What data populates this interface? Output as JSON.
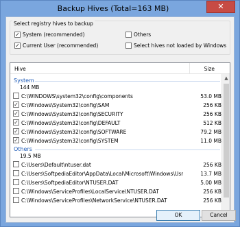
{
  "window": {
    "title": "Backup Hives (Total=163 MB)",
    "close_glyph": "✕"
  },
  "hive_select": {
    "legend": "Select registry hives to backup",
    "options": [
      {
        "label": "System (recommended)",
        "checked": true
      },
      {
        "label": "Current User (recommended)",
        "checked": true
      },
      {
        "label": "Others",
        "checked": false
      },
      {
        "label": "Select hives not loaded by Windows",
        "checked": false
      }
    ]
  },
  "list": {
    "col_hive": "Hive",
    "col_size": "Size",
    "groups": [
      {
        "title": "System",
        "size": "144 MB",
        "rows": [
          {
            "path": "C:\\WINDOWS\\system32\\config\\components",
            "size": "53.0 MB",
            "checked": false
          },
          {
            "path": "C:\\Windows\\System32\\config\\SAM",
            "size": "256 KB",
            "checked": true
          },
          {
            "path": "C:\\Windows\\System32\\config\\SECURITY",
            "size": "256 KB",
            "checked": true
          },
          {
            "path": "C:\\Windows\\System32\\config\\DEFAULT",
            "size": "512 KB",
            "checked": true
          },
          {
            "path": "C:\\Windows\\System32\\config\\SOFTWARE",
            "size": "79.2 MB",
            "checked": true
          },
          {
            "path": "C:\\Windows\\System32\\config\\SYSTEM",
            "size": "11.0 MB",
            "checked": true
          }
        ]
      },
      {
        "title": "Others",
        "size": "19.5 MB",
        "rows": [
          {
            "path": "C:\\Users\\Default\\ntuser.dat",
            "size": "256 KB",
            "checked": false
          },
          {
            "path": "C:\\Users\\SoftpediaEditor\\AppData\\Local\\Microsoft\\Windows\\Usr...",
            "size": "13.7 MB",
            "checked": false
          },
          {
            "path": "C:\\Users\\SoftpediaEditor\\NTUSER.DAT",
            "size": "5.00 MB",
            "checked": false
          },
          {
            "path": "C:\\Windows\\ServiceProfiles\\LocalService\\NTUSER.DAT",
            "size": "256 KB",
            "checked": false
          },
          {
            "path": "C:\\Windows\\ServiceProfiles\\NetworkService\\NTUSER.DAT",
            "size": "256 KB",
            "checked": false
          }
        ]
      }
    ]
  },
  "buttons": {
    "ok": "OK",
    "cancel": "Cancel"
  }
}
